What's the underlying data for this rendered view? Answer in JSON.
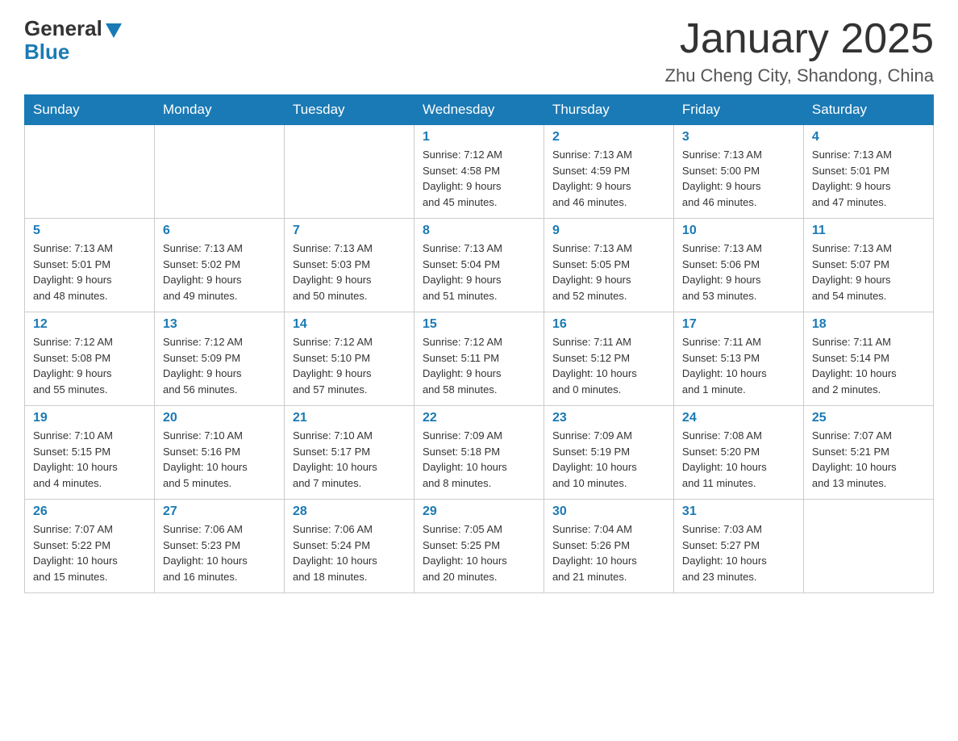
{
  "header": {
    "logo_general": "General",
    "logo_blue": "Blue",
    "month_title": "January 2025",
    "location": "Zhu Cheng City, Shandong, China"
  },
  "weekdays": [
    "Sunday",
    "Monday",
    "Tuesday",
    "Wednesday",
    "Thursday",
    "Friday",
    "Saturday"
  ],
  "weeks": [
    [
      {
        "day": "",
        "info": ""
      },
      {
        "day": "",
        "info": ""
      },
      {
        "day": "",
        "info": ""
      },
      {
        "day": "1",
        "info": "Sunrise: 7:12 AM\nSunset: 4:58 PM\nDaylight: 9 hours\nand 45 minutes."
      },
      {
        "day": "2",
        "info": "Sunrise: 7:13 AM\nSunset: 4:59 PM\nDaylight: 9 hours\nand 46 minutes."
      },
      {
        "day": "3",
        "info": "Sunrise: 7:13 AM\nSunset: 5:00 PM\nDaylight: 9 hours\nand 46 minutes."
      },
      {
        "day": "4",
        "info": "Sunrise: 7:13 AM\nSunset: 5:01 PM\nDaylight: 9 hours\nand 47 minutes."
      }
    ],
    [
      {
        "day": "5",
        "info": "Sunrise: 7:13 AM\nSunset: 5:01 PM\nDaylight: 9 hours\nand 48 minutes."
      },
      {
        "day": "6",
        "info": "Sunrise: 7:13 AM\nSunset: 5:02 PM\nDaylight: 9 hours\nand 49 minutes."
      },
      {
        "day": "7",
        "info": "Sunrise: 7:13 AM\nSunset: 5:03 PM\nDaylight: 9 hours\nand 50 minutes."
      },
      {
        "day": "8",
        "info": "Sunrise: 7:13 AM\nSunset: 5:04 PM\nDaylight: 9 hours\nand 51 minutes."
      },
      {
        "day": "9",
        "info": "Sunrise: 7:13 AM\nSunset: 5:05 PM\nDaylight: 9 hours\nand 52 minutes."
      },
      {
        "day": "10",
        "info": "Sunrise: 7:13 AM\nSunset: 5:06 PM\nDaylight: 9 hours\nand 53 minutes."
      },
      {
        "day": "11",
        "info": "Sunrise: 7:13 AM\nSunset: 5:07 PM\nDaylight: 9 hours\nand 54 minutes."
      }
    ],
    [
      {
        "day": "12",
        "info": "Sunrise: 7:12 AM\nSunset: 5:08 PM\nDaylight: 9 hours\nand 55 minutes."
      },
      {
        "day": "13",
        "info": "Sunrise: 7:12 AM\nSunset: 5:09 PM\nDaylight: 9 hours\nand 56 minutes."
      },
      {
        "day": "14",
        "info": "Sunrise: 7:12 AM\nSunset: 5:10 PM\nDaylight: 9 hours\nand 57 minutes."
      },
      {
        "day": "15",
        "info": "Sunrise: 7:12 AM\nSunset: 5:11 PM\nDaylight: 9 hours\nand 58 minutes."
      },
      {
        "day": "16",
        "info": "Sunrise: 7:11 AM\nSunset: 5:12 PM\nDaylight: 10 hours\nand 0 minutes."
      },
      {
        "day": "17",
        "info": "Sunrise: 7:11 AM\nSunset: 5:13 PM\nDaylight: 10 hours\nand 1 minute."
      },
      {
        "day": "18",
        "info": "Sunrise: 7:11 AM\nSunset: 5:14 PM\nDaylight: 10 hours\nand 2 minutes."
      }
    ],
    [
      {
        "day": "19",
        "info": "Sunrise: 7:10 AM\nSunset: 5:15 PM\nDaylight: 10 hours\nand 4 minutes."
      },
      {
        "day": "20",
        "info": "Sunrise: 7:10 AM\nSunset: 5:16 PM\nDaylight: 10 hours\nand 5 minutes."
      },
      {
        "day": "21",
        "info": "Sunrise: 7:10 AM\nSunset: 5:17 PM\nDaylight: 10 hours\nand 7 minutes."
      },
      {
        "day": "22",
        "info": "Sunrise: 7:09 AM\nSunset: 5:18 PM\nDaylight: 10 hours\nand 8 minutes."
      },
      {
        "day": "23",
        "info": "Sunrise: 7:09 AM\nSunset: 5:19 PM\nDaylight: 10 hours\nand 10 minutes."
      },
      {
        "day": "24",
        "info": "Sunrise: 7:08 AM\nSunset: 5:20 PM\nDaylight: 10 hours\nand 11 minutes."
      },
      {
        "day": "25",
        "info": "Sunrise: 7:07 AM\nSunset: 5:21 PM\nDaylight: 10 hours\nand 13 minutes."
      }
    ],
    [
      {
        "day": "26",
        "info": "Sunrise: 7:07 AM\nSunset: 5:22 PM\nDaylight: 10 hours\nand 15 minutes."
      },
      {
        "day": "27",
        "info": "Sunrise: 7:06 AM\nSunset: 5:23 PM\nDaylight: 10 hours\nand 16 minutes."
      },
      {
        "day": "28",
        "info": "Sunrise: 7:06 AM\nSunset: 5:24 PM\nDaylight: 10 hours\nand 18 minutes."
      },
      {
        "day": "29",
        "info": "Sunrise: 7:05 AM\nSunset: 5:25 PM\nDaylight: 10 hours\nand 20 minutes."
      },
      {
        "day": "30",
        "info": "Sunrise: 7:04 AM\nSunset: 5:26 PM\nDaylight: 10 hours\nand 21 minutes."
      },
      {
        "day": "31",
        "info": "Sunrise: 7:03 AM\nSunset: 5:27 PM\nDaylight: 10 hours\nand 23 minutes."
      },
      {
        "day": "",
        "info": ""
      }
    ]
  ]
}
